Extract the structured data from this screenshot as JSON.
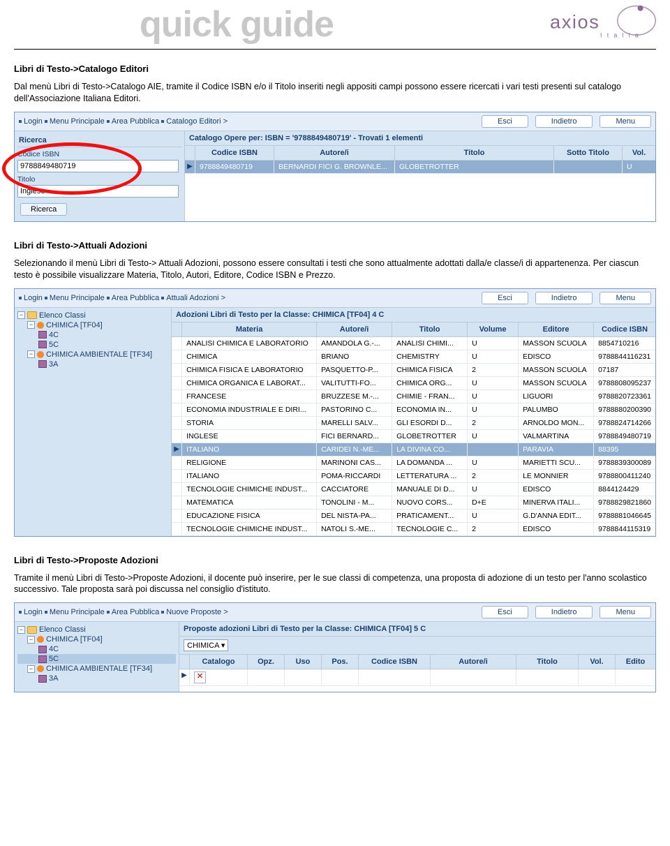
{
  "header": {
    "qg": "quick guide",
    "brand": "axios",
    "brand_sub": "I t a l i a"
  },
  "sec1": {
    "title": "Libri di Testo->Catalogo Editori",
    "body": "Dal menù Libri di Testo->Catalogo AIE, tramite il Codice ISBN e/o il Titolo inseriti negli appositi campi possono essere ricercati i vari testi presenti sul catalogo dell'Associazione Italiana Editori.",
    "bc": [
      "Login",
      "Menu Principale",
      "Area Pubblica",
      "Catalogo Editori >"
    ],
    "btn_esci": "Esci",
    "btn_indietro": "Indietro",
    "btn_menu": "Menu",
    "panel_title": "Ricerca",
    "lbl_isbn": "Codice ISBN",
    "val_isbn": "9788849480719",
    "lbl_titolo": "Titolo",
    "val_titolo": "Inglese",
    "btn_ricerca": "Ricerca",
    "right_title": "Catalogo Opere per: ISBN = '9788849480719' - Trovati 1 elementi",
    "cols": {
      "isbn": "Codice ISBN",
      "autore": "Autore/i",
      "titolo": "Titolo",
      "sotto": "Sotto Titolo",
      "vol": "Vol."
    },
    "row": {
      "isbn": "9788849480719",
      "autore": "BERNARDI FICI G. BROWNLE...",
      "titolo": "GLOBETROTTER",
      "sotto": "",
      "vol": "U"
    }
  },
  "sec2": {
    "title": "Libri di Testo->Attuali Adozioni",
    "body": "Selezionando il menù Libri di Testo-> Attuali Adozioni,  possono essere consultati i testi che sono attualmente adottati dalla/e classe/i di appartenenza. Per ciascun testo è possibile visualizzare Materia, Titolo, Autori, Editore, Codice ISBN e Prezzo.",
    "bc": [
      "Login",
      "Menu Principale",
      "Area Pubblica",
      "Attuali Adozioni >"
    ],
    "tree_root": "Elenco Classi",
    "tree": [
      {
        "name": "CHIMICA [TF04]",
        "children": [
          "4C",
          "5C"
        ]
      },
      {
        "name": "CHIMICA AMBIENTALE [TF34]",
        "children": [
          "3A"
        ]
      }
    ],
    "right_title": "Adozioni Libri di Testo per la Classe: CHIMICA [TF04] 4 C",
    "cols": {
      "materia": "Materia",
      "autore": "Autore/i",
      "titolo": "Titolo",
      "volume": "Volume",
      "editore": "Editore",
      "isbn": "Codice ISBN"
    },
    "rows": [
      {
        "m": "ANALISI CHIMICA E LABORATORIO",
        "a": "AMANDOLA G.-...",
        "t": "ANALISI CHIMI...",
        "v": "U",
        "e": "MASSON SCUOLA",
        "i": "8854710216"
      },
      {
        "m": "CHIMICA",
        "a": "BRIANO",
        "t": "CHEMISTRY",
        "v": "U",
        "e": "EDISCO",
        "i": "9788844116231"
      },
      {
        "m": "CHIMICA FISICA E LABORATORIO",
        "a": "PASQUETTO-P...",
        "t": "CHIMICA FISICA",
        "v": "2",
        "e": "MASSON SCUOLA",
        "i": "07187"
      },
      {
        "m": "CHIMICA ORGANICA E LABORAT...",
        "a": "VALITUTTI-FO...",
        "t": "CHIMICA ORG...",
        "v": "U",
        "e": "MASSON SCUOLA",
        "i": "9788808095237"
      },
      {
        "m": "FRANCESE",
        "a": "BRUZZESE M.-...",
        "t": "CHIMIE - FRAN...",
        "v": "U",
        "e": "LIGUORI",
        "i": "9788820723361"
      },
      {
        "m": "ECONOMIA INDUSTRIALE E DIRI...",
        "a": "PASTORINO C...",
        "t": "ECONOMIA IN...",
        "v": "U",
        "e": "PALUMBO",
        "i": "9788880200390"
      },
      {
        "m": "STORIA",
        "a": "MARELLI SALV...",
        "t": "GLI ESORDI D...",
        "v": "2",
        "e": "ARNOLDO MON...",
        "i": "9788824714266"
      },
      {
        "m": "INGLESE",
        "a": "FICI BERNARD...",
        "t": "GLOBETROTTER",
        "v": "U",
        "e": "VALMARTINA",
        "i": "9788849480719"
      },
      {
        "m": "ITALIANO",
        "a": "CARIDEI N.-ME...",
        "t": "LA DIVINA CO...",
        "v": "",
        "e": "PARAVIA",
        "i": "88395",
        "sel": true
      },
      {
        "m": "RELIGIONE",
        "a": "MARINONI CAS...",
        "t": "LA DOMANDA ...",
        "v": "U",
        "e": "MARIETTI SCU...",
        "i": "9788839300089"
      },
      {
        "m": "ITALIANO",
        "a": "POMA-RICCARDI",
        "t": "LETTERATURA ...",
        "v": "2",
        "e": "LE MONNIER",
        "i": "9788800411240"
      },
      {
        "m": "TECNOLOGIE CHIMICHE INDUST...",
        "a": "CACCIATORE",
        "t": "MANUALE DI D...",
        "v": "U",
        "e": "EDISCO",
        "i": "8844124429"
      },
      {
        "m": "MATEMATICA",
        "a": "TONOLINI - M...",
        "t": "NUOVO CORS...",
        "v": "D+E",
        "e": "MINERVA ITALI...",
        "i": "9788829821860"
      },
      {
        "m": "EDUCAZIONE FISICA",
        "a": "DEL NISTA-PA...",
        "t": "PRATICAMENT...",
        "v": "U",
        "e": "G.D'ANNA EDIT...",
        "i": "9788881046645"
      },
      {
        "m": "TECNOLOGIE CHIMICHE INDUST...",
        "a": "NATOLI S.-ME...",
        "t": "TECNOLOGIE C...",
        "v": "2",
        "e": "EDISCO",
        "i": "9788844115319"
      }
    ]
  },
  "sec3": {
    "title": "Libri di Testo->Proposte Adozioni",
    "body": "Tramite il menù Libri di Testo->Proposte Adozioni, il docente può inserire, per le sue classi di competenza, una proposta di adozione di un testo per l'anno scolastico successivo. Tale proposta sarà poi discussa nel consiglio d'istituto.",
    "bc": [
      "Login",
      "Menu Principale",
      "Area Pubblica",
      "Nuove Proposte >"
    ],
    "right_title": "Proposte adozioni Libri di Testo per la Classe: CHIMICA [TF04] 5 C",
    "sel_value": "CHIMICA",
    "cols": {
      "catalogo": "Catalogo",
      "opz": "Opz.",
      "uso": "Uso",
      "pos": "Pos.",
      "isbn": "Codice ISBN",
      "autore": "Autore/i",
      "titolo": "Titolo",
      "vol": "Vol.",
      "edito": "Edito"
    },
    "tree": [
      {
        "name": "CHIMICA [TF04]",
        "children": [
          "4C",
          "5C"
        ]
      },
      {
        "name": "CHIMICA AMBIENTALE [TF34]",
        "children": [
          "3A"
        ]
      }
    ]
  }
}
